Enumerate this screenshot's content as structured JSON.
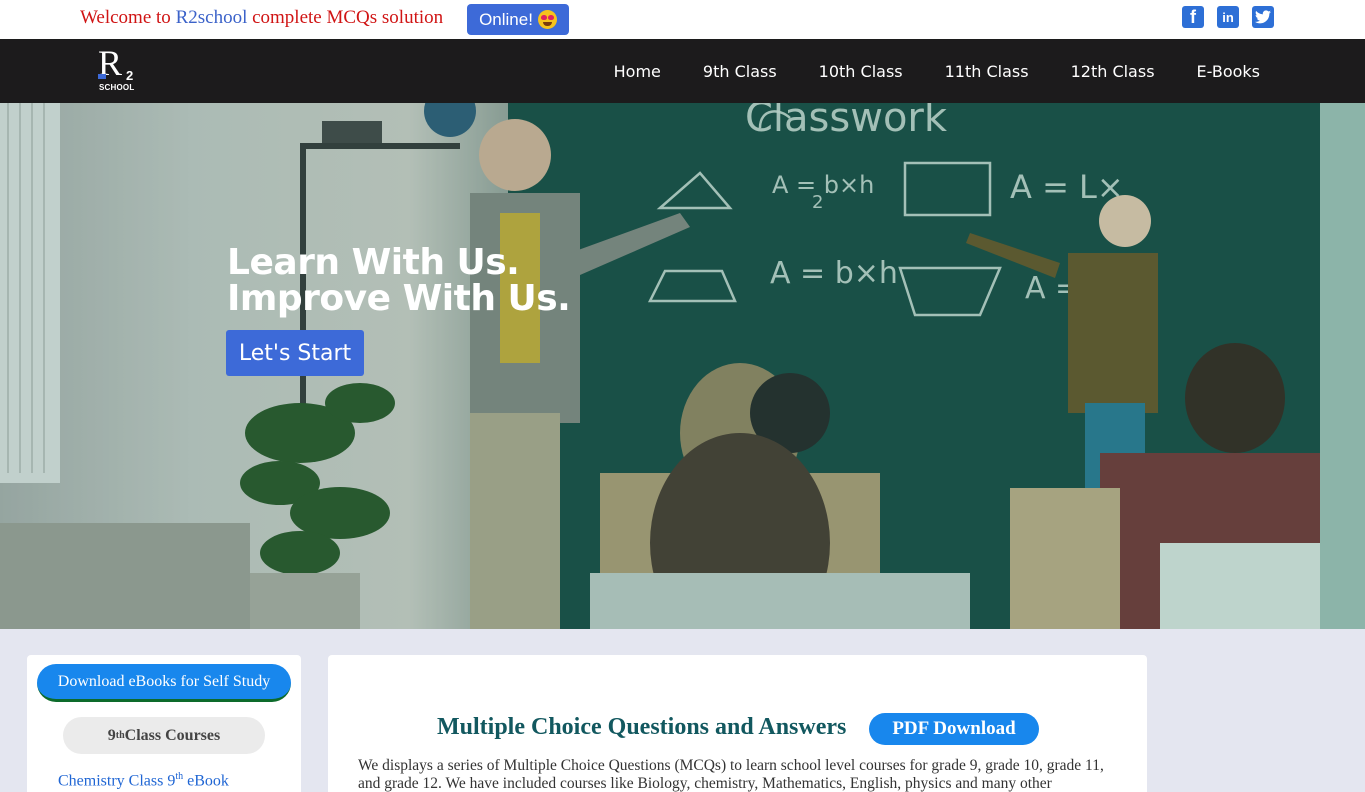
{
  "topbar": {
    "welcome_prefix": "Welcome to ",
    "welcome_brand": "R2school",
    "welcome_suffix": " complete MCQs solution",
    "online_label": "Online!",
    "online_emoji": "star-struck-emoji",
    "social": [
      {
        "name": "facebook-icon",
        "glyph": "f"
      },
      {
        "name": "linkedin-icon",
        "glyph": "in"
      },
      {
        "name": "twitter-icon",
        "glyph": "t"
      }
    ]
  },
  "nav": {
    "logo_letter": "R",
    "logo_sub": "2",
    "logo_text": "SCHOOL",
    "links": [
      "Home",
      "9th Class",
      "10th Class",
      "11th Class",
      "12th Class",
      "E-Books"
    ]
  },
  "hero": {
    "line1": "Learn With Us.",
    "line2": "Improve With Us.",
    "cta": "Let's Start"
  },
  "sidebar": {
    "download_label": "Download eBooks for Self Study",
    "course_number": "9",
    "course_suffix": "th",
    "course_label": " Class Courses",
    "link_prefix": "Chemistry Class 9",
    "link_suffix": "th",
    "link_end": " eBook"
  },
  "main": {
    "title": "Multiple Choice Questions and Answers",
    "pdf_label": "PDF Download",
    "intro": "We displays a series of Multiple Choice Questions (MCQs) to learn school level courses for grade 9, grade 10, grade 11, and grade 12. We have included courses like Biology, chemistry, Mathematics, English, physics and many other"
  },
  "colors": {
    "accent": "#3d6ad8",
    "nav_bg": "#1c1b1c",
    "welcome_red": "#d01414",
    "title_teal": "#12585f",
    "pill_blue": "#1887ed",
    "page_bg": "#e4e6f0"
  }
}
